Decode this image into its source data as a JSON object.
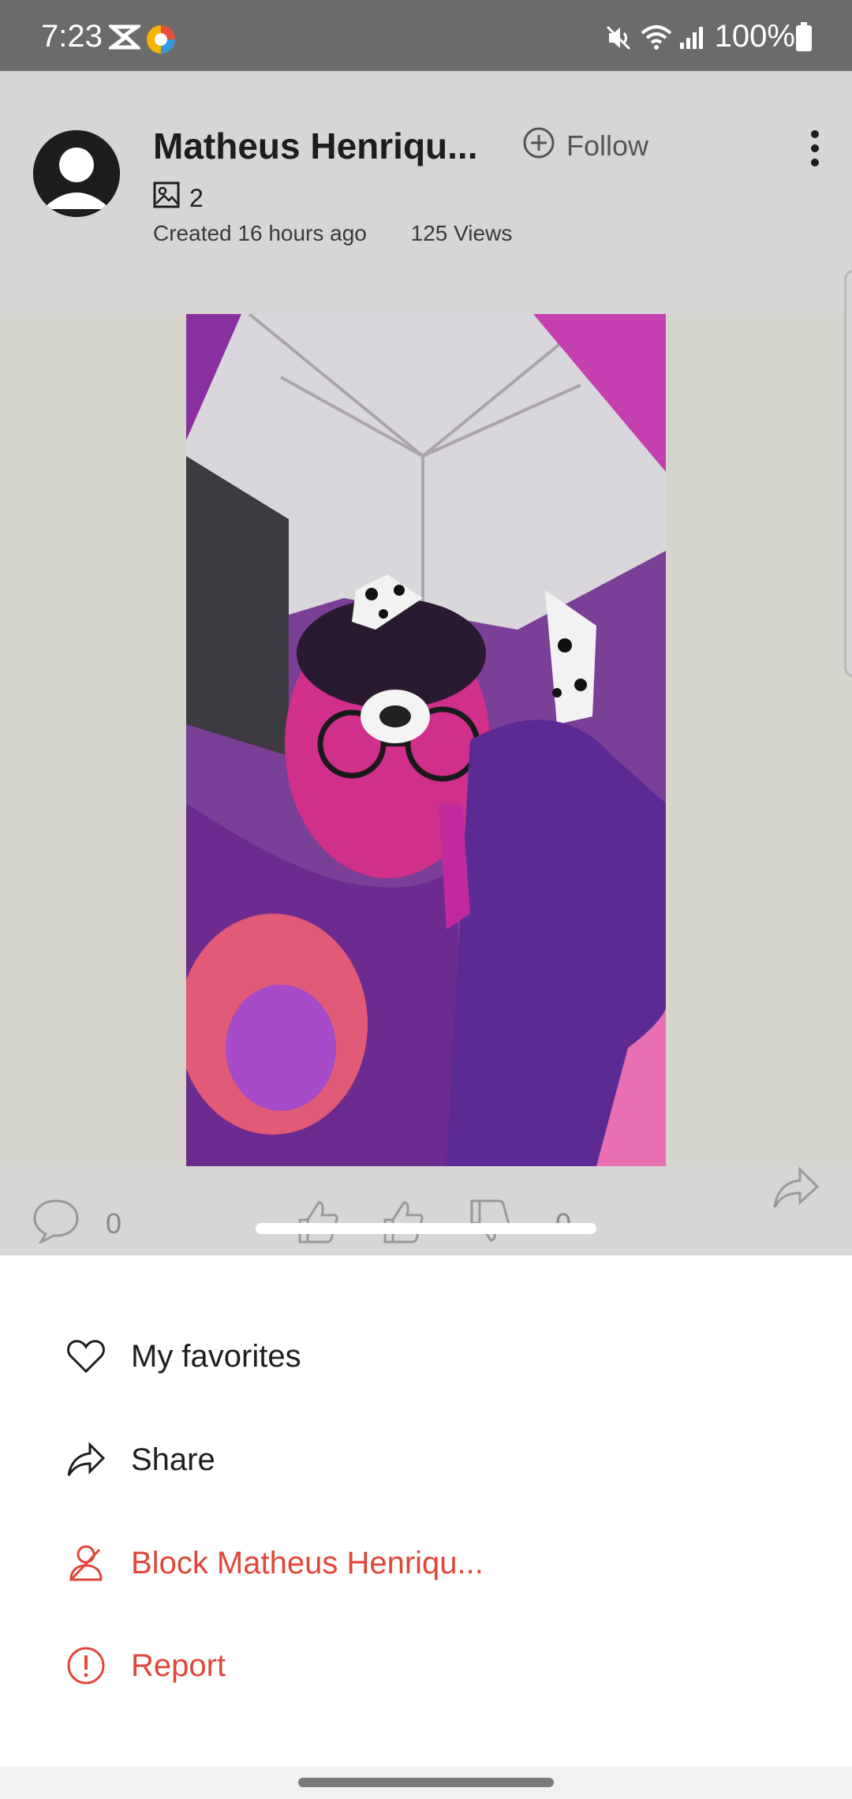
{
  "status_bar": {
    "time": "7:23",
    "battery": "100%",
    "icons": [
      "capcut-icon",
      "app-logo-icon",
      "mute-icon",
      "wifi-icon",
      "signal-icon",
      "battery-icon"
    ]
  },
  "post": {
    "author_name": "Matheus Henriqu...",
    "follow_label": "Follow",
    "image_count": "2",
    "created": "Created 16 hours ago",
    "views": "125 Views"
  },
  "reactions": {
    "comment_count": "0",
    "reaction_count": "0"
  },
  "menu": {
    "favorites": "My favorites",
    "share": "Share",
    "block": "Block Matheus Henriqu...",
    "report": "Report"
  },
  "colors": {
    "danger": "#e0473a",
    "accent_photo": "#c2299c"
  }
}
